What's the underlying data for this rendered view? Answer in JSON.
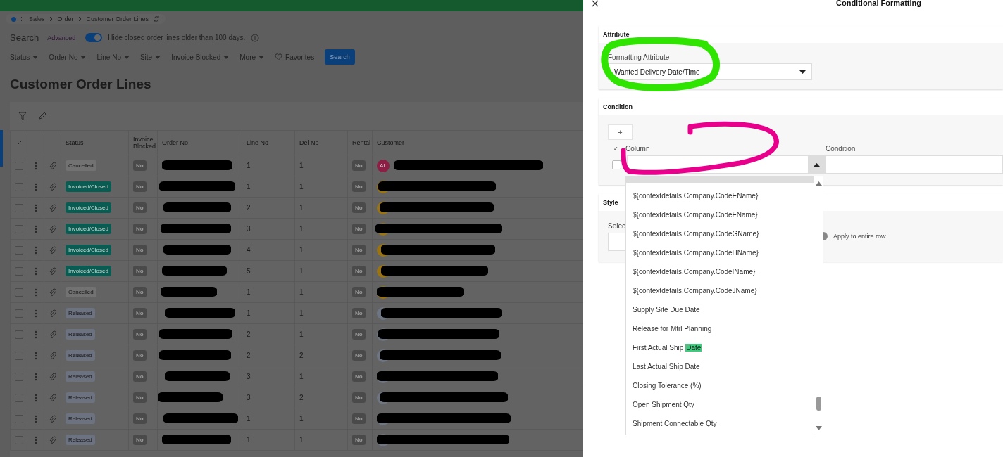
{
  "breadcrumb": [
    "Sales",
    "Order",
    "Customer Order Lines"
  ],
  "search": {
    "label": "Search",
    "advanced": "Advanced",
    "hide_closed": {
      "on": true,
      "label": "Hide closed order lines older than 100 days."
    }
  },
  "filters": [
    "Status",
    "Order No",
    "Line No",
    "Site",
    "Invoice Blocked",
    "More"
  ],
  "favorites": "Favorites",
  "search_button": "Search",
  "page_title": "Customer Order Lines",
  "table": {
    "columns": [
      "Status",
      "Invoice Blocked",
      "Order No",
      "Line No",
      "Del No",
      "Rental",
      "Customer"
    ],
    "rows": [
      {
        "checked": false,
        "status": {
          "text": "Cancelled",
          "color": "#727272"
        },
        "invoice_blocked": "No",
        "line_no": "1",
        "del_no": "1",
        "rental": "No",
        "avatar": {
          "color": "#8c1f45",
          "initials": "AL"
        }
      },
      {
        "checked": false,
        "status": {
          "text": "Invoiced/Closed",
          "color": "#0a5c52"
        },
        "invoice_blocked": "No",
        "line_no": "1",
        "del_no": "1",
        "rental": "No",
        "avatar": {
          "color": "#9a7412"
        }
      },
      {
        "checked": false,
        "status": {
          "text": "Invoiced/Closed",
          "color": "#0a5c52"
        },
        "invoice_blocked": "No",
        "line_no": "2",
        "del_no": "1",
        "rental": "No",
        "avatar": {
          "color": "#9a7412"
        }
      },
      {
        "checked": false,
        "status": {
          "text": "Invoiced/Closed",
          "color": "#0a5c52"
        },
        "invoice_blocked": "No",
        "line_no": "3",
        "del_no": "1",
        "rental": "No",
        "avatar": {
          "color": "#9a7412"
        }
      },
      {
        "checked": false,
        "status": {
          "text": "Invoiced/Closed",
          "color": "#0a5c52"
        },
        "invoice_blocked": "No",
        "line_no": "4",
        "del_no": "1",
        "rental": "No",
        "avatar": {
          "color": "#9a7412"
        }
      },
      {
        "checked": false,
        "status": {
          "text": "Invoiced/Closed",
          "color": "#0a5c52"
        },
        "invoice_blocked": "No",
        "line_no": "5",
        "del_no": "1",
        "rental": "No",
        "avatar": {
          "color": "#9a7412"
        }
      },
      {
        "checked": false,
        "status": {
          "text": "Cancelled",
          "color": "#727272"
        },
        "invoice_blocked": "No",
        "line_no": "1",
        "del_no": "1",
        "rental": "No",
        "avatar": {
          "color": "#9a7412"
        }
      },
      {
        "checked": false,
        "status": {
          "text": "Released",
          "color": "#6c7280"
        },
        "invoice_blocked": "No",
        "line_no": "1",
        "del_no": "1",
        "rental": "No",
        "avatar": {
          "color": "#6e7684"
        }
      },
      {
        "checked": false,
        "status": {
          "text": "Released",
          "color": "#6c7280"
        },
        "invoice_blocked": "No",
        "line_no": "2",
        "del_no": "1",
        "rental": "No",
        "avatar": {
          "color": "#6e7684"
        }
      },
      {
        "checked": false,
        "status": {
          "text": "Released",
          "color": "#6c7280"
        },
        "invoice_blocked": "No",
        "line_no": "2",
        "del_no": "2",
        "rental": "No",
        "avatar": {
          "color": "#6e7684"
        }
      },
      {
        "checked": false,
        "status": {
          "text": "Released",
          "color": "#6c7280"
        },
        "invoice_blocked": "No",
        "line_no": "3",
        "del_no": "1",
        "rental": "No",
        "avatar": {
          "color": "#6e7684"
        }
      },
      {
        "checked": false,
        "status": {
          "text": "Released",
          "color": "#6c7280"
        },
        "invoice_blocked": "No",
        "line_no": "3",
        "del_no": "2",
        "rental": "No",
        "avatar": {
          "color": "#6e7684"
        }
      },
      {
        "checked": false,
        "status": {
          "text": "Released",
          "color": "#6c7280"
        },
        "invoice_blocked": "No",
        "line_no": "1",
        "del_no": "1",
        "rental": "No",
        "avatar": {
          "color": "#6e7684"
        }
      },
      {
        "checked": false,
        "status": {
          "text": "Released",
          "color": "#6c7280"
        },
        "invoice_blocked": "No",
        "line_no": "1",
        "del_no": "1",
        "rental": "No",
        "avatar": {
          "color": "#6e7684"
        }
      }
    ]
  },
  "panel": {
    "title": "Conditional Formatting",
    "attribute": {
      "heading": "Attribute",
      "label": "Formatting Attribute",
      "value": "Wanted Delivery Date/Time"
    },
    "condition": {
      "heading": "Condition",
      "add": "+",
      "check_header": "✓",
      "column_header": "Column",
      "condition_header": "Condition",
      "row_checked": false
    },
    "style": {
      "heading": "Style",
      "label": "Selec",
      "apply_entire_row": {
        "on": false,
        "label": "Apply to entire row"
      }
    },
    "column_options": [
      {
        "label": "${contextdetails.Company.CodeEName}"
      },
      {
        "label": "${contextdetails.Company.CodeFName}"
      },
      {
        "label": "${contextdetails.Company.CodeGName}"
      },
      {
        "label": "${contextdetails.Company.CodeHName}"
      },
      {
        "label": "${contextdetails.Company.CodeIName}"
      },
      {
        "label": "${contextdetails.Company.CodeJName}"
      },
      {
        "label": "Supply Site Due Date"
      },
      {
        "label": "Release for Mtrl Planning"
      },
      {
        "label": "First Actual Ship",
        "highlight": "Date"
      },
      {
        "label": "Last Actual Ship Date"
      },
      {
        "label": "Closing Tolerance (%)"
      },
      {
        "label": "Open Shipment Qty"
      },
      {
        "label": "Shipment Connectable Qty"
      }
    ]
  }
}
